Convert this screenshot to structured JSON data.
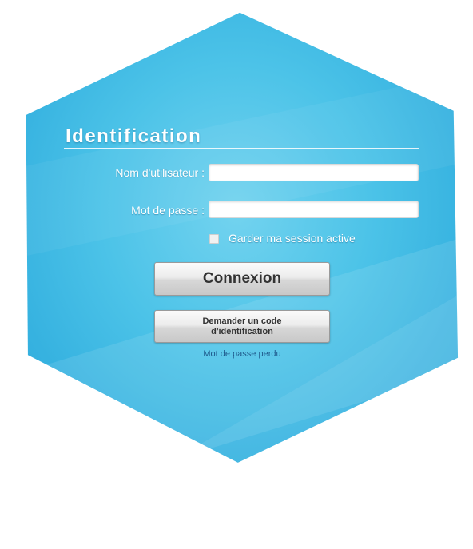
{
  "login": {
    "title": "Identification",
    "username_label": "Nom d'utilisateur :",
    "username_value": "",
    "password_label": "Mot de passe :",
    "password_value": "",
    "remember_label": "Garder ma session active",
    "remember_checked": false,
    "connexion_label": "Connexion",
    "request_code_line1": "Demander un code",
    "request_code_line2": "d'identification",
    "lost_password_link": "Mot de passe perdu"
  },
  "colors": {
    "background": "#ffffff",
    "hexagon": "#4cc3e8",
    "button": "#e6e6e6",
    "link": "#1f5a8c"
  }
}
